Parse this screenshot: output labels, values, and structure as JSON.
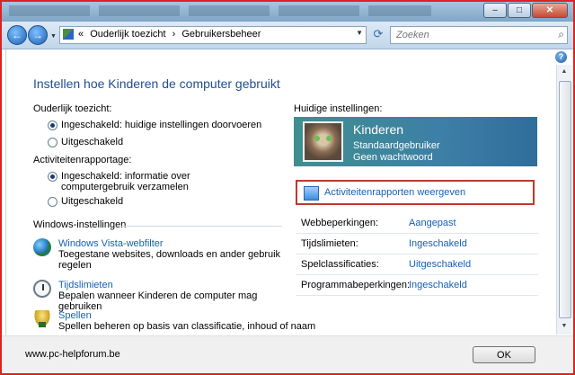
{
  "address": {
    "crumbs": [
      "«",
      "Ouderlijk toezicht",
      "›",
      "Gebruikersbeheer"
    ]
  },
  "search": {
    "placeholder": "Zoeken"
  },
  "page_title": "Instellen hoe Kinderen de computer gebruikt",
  "parental": {
    "label": "Ouderlijk toezicht:",
    "on": "Ingeschakeld: huidige instellingen doorvoeren",
    "off": "Uitgeschakeld",
    "selected": "on"
  },
  "activity_reporting": {
    "label": "Activiteitenrapportage:",
    "on": "Ingeschakeld: informatie over computergebruik verzamelen",
    "off": "Uitgeschakeld",
    "selected": "on"
  },
  "windows_settings": {
    "title": "Windows-instellingen",
    "items": [
      {
        "icon": "globe-icon",
        "link": "Windows Vista-webfilter",
        "desc": "Toegestane websites, downloads en ander gebruik regelen"
      },
      {
        "icon": "clock-icon",
        "link": "Tijdslimieten",
        "desc": "Bepalen wanneer Kinderen de computer mag gebruiken"
      },
      {
        "icon": "trophy-icon",
        "link": "Spellen",
        "desc": "Spellen beheren op basis van classificatie, inhoud of naam"
      }
    ]
  },
  "current": {
    "title": "Huidige instellingen:",
    "user_name": "Kinderen",
    "user_type": "Standaardgebruiker",
    "password": "Geen wachtwoord",
    "activity_link": "Activiteitenrapporten weergeven",
    "rows": [
      {
        "label": "Webbeperkingen:",
        "value": "Aangepast"
      },
      {
        "label": "Tijdslimieten:",
        "value": "Ingeschakeld"
      },
      {
        "label": "Spelclassificaties:",
        "value": "Uitgeschakeld"
      },
      {
        "label": "Programmabeperkingen:",
        "value": "Ingeschakeld"
      }
    ]
  },
  "footer": {
    "text": "www.pc-helpforum.be",
    "ok_label": "OK"
  },
  "colors": {
    "link": "#1560b8",
    "title": "#1f4e93",
    "highlight_border": "#c0392b"
  }
}
